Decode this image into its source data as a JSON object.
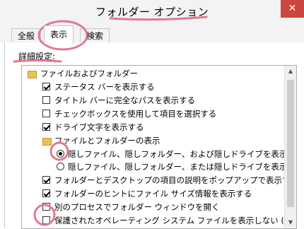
{
  "window": {
    "title": "フォルダー オプション",
    "close_label": "✕"
  },
  "tabs": [
    {
      "label": "全般"
    },
    {
      "label": "表示"
    },
    {
      "label": "検索"
    }
  ],
  "section_label": "詳細設定:",
  "tree": [
    {
      "type": "folder",
      "label": "ファイルおよびフォルダー"
    },
    {
      "type": "checkbox",
      "checked": true,
      "label": "ステータス バーを表示する"
    },
    {
      "type": "checkbox",
      "checked": false,
      "label": "タイトル バーに完全なパスを表示する"
    },
    {
      "type": "checkbox",
      "checked": false,
      "label": "チェックボックスを使用して項目を選択する"
    },
    {
      "type": "checkbox",
      "checked": true,
      "label": "ドライブ文字を表示する"
    },
    {
      "type": "folder",
      "label": "ファイルとフォルダーの表示"
    },
    {
      "type": "radio",
      "checked": true,
      "label": "隠しファイル、隠しフォルダー、および隠しドライブを表示する"
    },
    {
      "type": "radio",
      "checked": false,
      "label": "隠しファイル、隠しフォルダー、または隠しドライブを表示しない"
    },
    {
      "type": "checkbox",
      "checked": true,
      "label": "フォルダーとデスクトップの項目の説明をポップアップで表示する"
    },
    {
      "type": "checkbox",
      "checked": true,
      "label": "フォルダーのヒントにファイル サイズ情報を表示する"
    },
    {
      "type": "checkbox",
      "checked": false,
      "label": "別のプロセスでフォルダー ウィンドウを開く"
    },
    {
      "type": "checkbox",
      "checked": false,
      "label": "保護されたオペレーティング システム ファイルを表示しない (推奨)"
    }
  ],
  "scrollbar": {
    "up_glyph": "▲",
    "down_glyph": "▼"
  },
  "colors": {
    "annotation": "#e07a8f",
    "close_button": "#c9473c"
  }
}
